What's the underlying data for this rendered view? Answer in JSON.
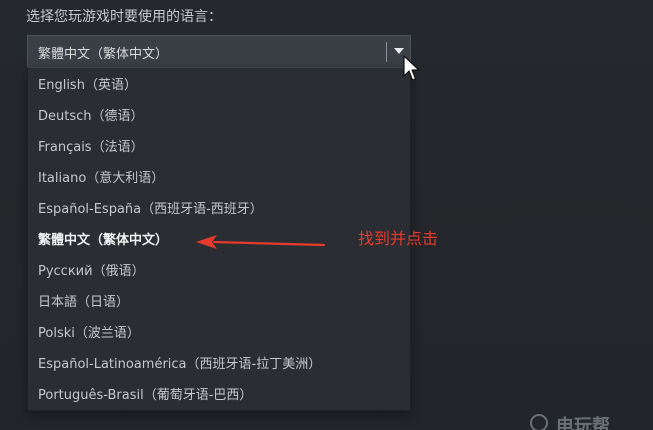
{
  "prompt": {
    "label": "选择您玩游戏时要使用的语言："
  },
  "language_select": {
    "selected_value": "繁體中文（繁体中文）",
    "options": [
      {
        "label": "English（英语）"
      },
      {
        "label": "Deutsch（德语）"
      },
      {
        "label": "Français（法语）"
      },
      {
        "label": "Italiano（意大利语）"
      },
      {
        "label": "Español-España（西班牙语-西班牙）"
      },
      {
        "label": "繁體中文（繁体中文）",
        "selected": true
      },
      {
        "label": "Русский（俄语）"
      },
      {
        "label": "日本語（日语）"
      },
      {
        "label": "Polski（波兰语）"
      },
      {
        "label": "Español-Latinoamérica（西班牙语-拉丁美洲）"
      },
      {
        "label": "Português-Brasil（葡萄牙语-巴西）"
      }
    ]
  },
  "annotation": {
    "text": "找到并点击",
    "color": "#e63a2e"
  },
  "watermark": {
    "text": "电玩帮"
  },
  "icons": {
    "dropdown": "chevron-down-icon",
    "cursor": "mouse-pointer-icon",
    "arrow": "red-arrow-icon"
  }
}
